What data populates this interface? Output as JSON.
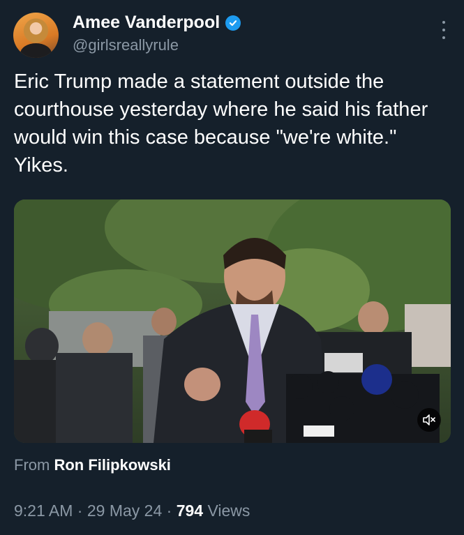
{
  "author": {
    "name": "Amee Vanderpool",
    "handle": "@girlsreallyrule"
  },
  "tweet": {
    "text": "Eric Trump made a statement outside the courthouse yesterday where he said his father would win this case because \"we're white.\" Yikes."
  },
  "attribution": {
    "prefix": "From",
    "source": "Ron Filipkowski"
  },
  "meta": {
    "time": "9:21 AM",
    "sep1": "·",
    "date": "29 May 24",
    "sep2": "·",
    "views_count": "794",
    "views_label": "Views"
  },
  "colors": {
    "background": "#15202b",
    "secondary_text": "#8b98a5",
    "verified": "#1d9bf0"
  },
  "icons": {
    "verified": "verified-badge-icon",
    "more": "more-vertical-icon",
    "mute": "speaker-muted-icon"
  }
}
